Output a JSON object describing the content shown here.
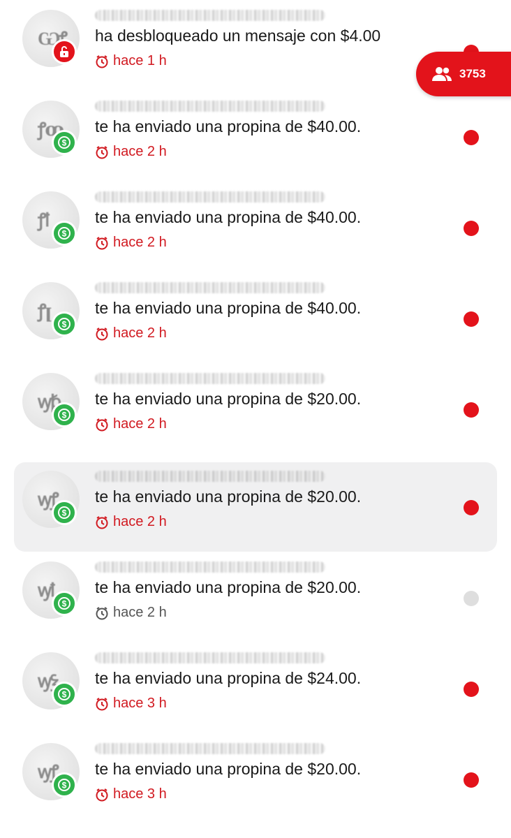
{
  "online_counter": {
    "count": "3753",
    "icon": "people-icon"
  },
  "notifications": [
    {
      "message": "ha desbloqueado un mensaje con $4.00",
      "time": "hace 1 h",
      "badge": "lock-icon",
      "unread": true
    },
    {
      "message": "te ha enviado una propina de $40.00.",
      "time": "hace 2 h",
      "badge": "dollar-icon",
      "unread": true
    },
    {
      "message": "te ha enviado una propina de $40.00.",
      "time": "hace 2 h",
      "badge": "dollar-icon",
      "unread": true
    },
    {
      "message": "te ha enviado una propina de $40.00.",
      "time": "hace 2 h",
      "badge": "dollar-icon",
      "unread": true
    },
    {
      "message": "te ha enviado una propina de $20.00.",
      "time": "hace 2 h",
      "badge": "dollar-icon",
      "unread": true
    },
    {
      "message": "te ha enviado una propina de $20.00.",
      "time": "hace 2 h",
      "badge": "dollar-icon",
      "unread": true,
      "highlighted": true
    },
    {
      "message": "te ha enviado una propina de $20.00.",
      "time": "hace 2 h",
      "badge": "dollar-icon",
      "unread": false
    },
    {
      "message": "te ha enviado una propina de $24.00.",
      "time": "hace 3 h",
      "badge": "dollar-icon",
      "unread": true
    },
    {
      "message": "te ha enviado una propina de $20.00.",
      "time": "hace 3 h",
      "badge": "dollar-icon",
      "unread": true
    }
  ],
  "colors": {
    "accent": "#e3131b",
    "tip_badge": "#2fb24c",
    "read_dot": "#dedede",
    "highlight_bg": "#f0f0f1"
  }
}
